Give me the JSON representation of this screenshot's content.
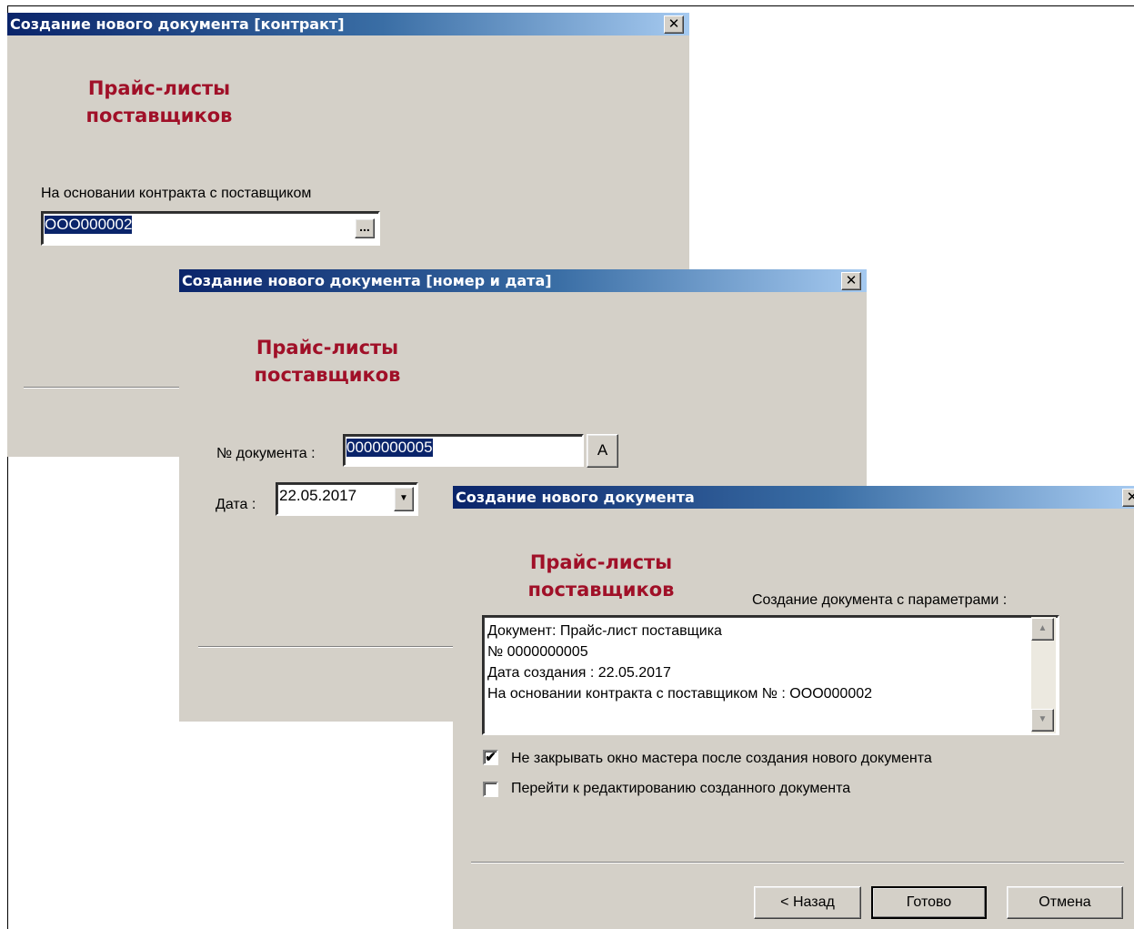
{
  "dialog1": {
    "title": "Создание нового документа [контракт]",
    "close": "✕",
    "brand_line1": "Прайс-листы",
    "brand_line2": "поставщиков",
    "contract_label": "На основании контракта с поставщиком",
    "contract_value": "ООО000002",
    "browse_button": "..."
  },
  "dialog2": {
    "title": "Создание нового документа [номер и дата]",
    "close": "✕",
    "brand_line1": "Прайс-листы",
    "brand_line2": "поставщиков",
    "number_label": "№ документа :",
    "number_value": "0000000005",
    "auto_button": "А",
    "date_label": "Дата :",
    "date_value": "22.05.2017",
    "date_dropdown": "▼"
  },
  "dialog3": {
    "title": "Создание нового документа",
    "close": "✕",
    "brand_line1": "Прайс-листы",
    "brand_line2": "поставщиков",
    "params_label": "Создание документа с параметрами :",
    "params_lines": [
      "Документ: Прайс-лист поставщика",
      "№ 0000000005",
      "Дата создания : 22.05.2017",
      "На основании контракта с поставщиком № : ООО000002"
    ],
    "checkbox1_label": "Не закрывать окно мастера после создания нового документа",
    "checkbox1_checked": true,
    "checkbox2_label": "Перейти к редактированию созданного документа",
    "checkbox2_checked": false,
    "back_button": "< Назад",
    "finish_button": "Готово",
    "cancel_button": "Отмена",
    "scroll_up": "▲",
    "scroll_down": "▼"
  }
}
